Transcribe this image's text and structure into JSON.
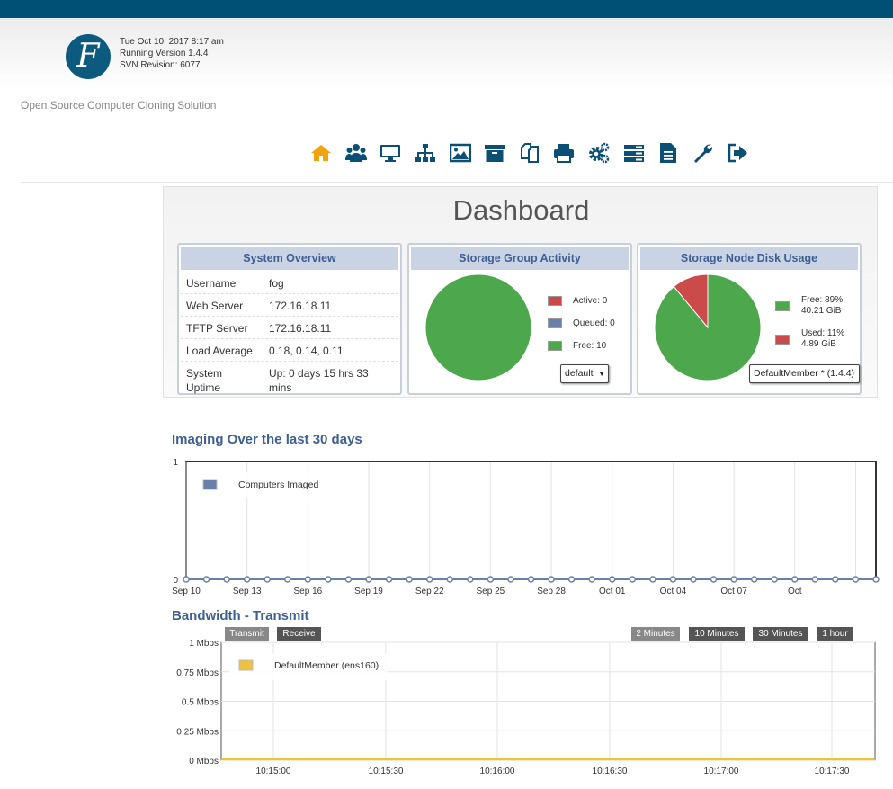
{
  "header": {
    "date": "Tue Oct 10, 2017 8:17 am",
    "version": "Running Version 1.4.4",
    "svn": "SVN Revision: 6077",
    "logo_letter": "F",
    "tagline": "Open Source Computer Cloning Solution"
  },
  "menu": [
    {
      "name": "home-icon",
      "color": "#f0a30a"
    },
    {
      "name": "users-icon",
      "color": "#0c4f74"
    },
    {
      "name": "monitor-icon",
      "color": "#0c4f74"
    },
    {
      "name": "sitemap-icon",
      "color": "#0c4f74"
    },
    {
      "name": "image-icon",
      "color": "#0c4f74"
    },
    {
      "name": "archive-icon",
      "color": "#0c4f74"
    },
    {
      "name": "copy-icon",
      "color": "#0c4f74"
    },
    {
      "name": "printer-icon",
      "color": "#0c4f74"
    },
    {
      "name": "cogs-icon",
      "color": "#0c4f74"
    },
    {
      "name": "server-icon",
      "color": "#0c4f74"
    },
    {
      "name": "file-icon",
      "color": "#0c4f74"
    },
    {
      "name": "wrench-icon",
      "color": "#0c4f74"
    },
    {
      "name": "sign-out-icon",
      "color": "#0c4f74"
    }
  ],
  "dashboard": {
    "title": "Dashboard",
    "overview": {
      "title": "System Overview",
      "rows": [
        {
          "k": "Username",
          "v": "fog"
        },
        {
          "k": "Web Server",
          "v": "172.16.18.11"
        },
        {
          "k": "TFTP Server",
          "v": "172.16.18.11"
        },
        {
          "k": "Load Average",
          "v": "0.18, 0.14, 0.11"
        },
        {
          "k": "System Uptime",
          "v": "Up: 0 days 15 hrs 33 mins"
        }
      ]
    },
    "storage_group": {
      "title": "Storage Group Activity",
      "legend": [
        {
          "label": "Active: 0",
          "color": "#cb4b4b"
        },
        {
          "label": "Queued: 0",
          "color": "#6a80a8"
        },
        {
          "label": "Free: 10",
          "color": "#4da74d"
        }
      ],
      "select": "default"
    },
    "storage_node": {
      "title": "Storage Node Disk Usage",
      "legend": [
        {
          "label": "Free: 89%",
          "sub": "40.21 GiB",
          "color": "#4da74d"
        },
        {
          "label": "Used: 11%",
          "sub": "4.89 GiB",
          "color": "#cb4b4b"
        }
      ],
      "select": "DefaultMember * (1.4.4)"
    }
  },
  "imaging": {
    "title": "Imaging Over the last 30 days",
    "legend": "Computers Imaged",
    "legend_color": "#6a80a8"
  },
  "bandwidth": {
    "title": "Bandwidth - Transmit",
    "tabs": [
      "Transmit",
      "Receive"
    ],
    "ranges": [
      "2 Minutes",
      "10 Minutes",
      "30 Minutes",
      "1 hour"
    ],
    "legend": "DefaultMember (ens160)",
    "legend_color": "#edc240"
  },
  "chart_data": [
    {
      "type": "pie",
      "categories": [
        "Active",
        "Queued",
        "Free"
      ],
      "values": [
        0,
        0,
        10
      ],
      "colors": [
        "#cb4b4b",
        "#6a80a8",
        "#4da74d"
      ]
    },
    {
      "type": "pie",
      "categories": [
        "Free",
        "Used"
      ],
      "values": [
        89,
        11
      ],
      "colors": [
        "#4da74d",
        "#cb4b4b"
      ]
    },
    {
      "type": "line",
      "title": "Imaging Over the last 30 days",
      "series": [
        {
          "name": "Computers Imaged",
          "values": [
            0,
            0,
            0,
            0,
            0,
            0,
            0,
            0,
            0,
            0,
            0,
            0,
            0,
            0,
            0,
            0,
            0,
            0,
            0,
            0,
            0,
            0,
            0,
            0,
            0,
            0,
            0,
            0,
            0,
            0,
            0,
            0,
            0,
            0,
            0
          ]
        }
      ],
      "tick_labels": [
        "Sep 10",
        "Sep 13",
        "Sep 16",
        "Sep 19",
        "Sep 22",
        "Sep 25",
        "Sep 28",
        "Oct 01",
        "Oct 04",
        "Oct 07",
        "Oct"
      ],
      "ylim": [
        0,
        1
      ],
      "yticks": [
        "0",
        "1"
      ],
      "grid": true,
      "legend_position": "top-left"
    },
    {
      "type": "area",
      "title": "Bandwidth - Transmit",
      "series": [
        {
          "name": "DefaultMember (ens160)",
          "values": [
            0,
            0
          ]
        }
      ],
      "tick_labels": [
        "10:15:00",
        "10:15:30",
        "10:16:00",
        "10:16:30",
        "10:17:00",
        "10:17:30"
      ],
      "yticks": [
        "1 Mbps",
        "0.75 Mbps",
        "0.5 Mbps",
        "0.25 Mbps",
        "0 Mbps"
      ],
      "ylim": [
        0,
        1
      ],
      "grid": true,
      "legend_position": "top-left"
    }
  ]
}
